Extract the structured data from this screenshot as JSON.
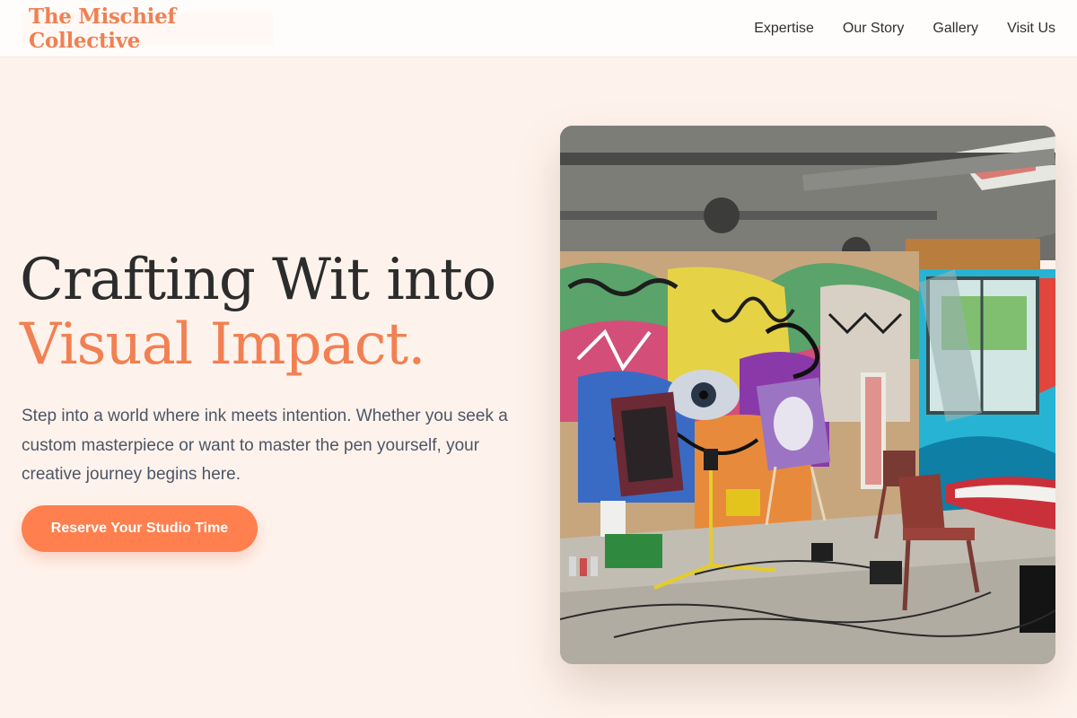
{
  "brand": {
    "name": "The Mischief Collective"
  },
  "nav": {
    "items": [
      {
        "label": "Expertise"
      },
      {
        "label": "Our Story"
      },
      {
        "label": "Gallery"
      },
      {
        "label": "Visit Us"
      }
    ]
  },
  "hero": {
    "title_line1": "Crafting Wit into",
    "title_line2": "Visual Impact.",
    "description": "Step into a world where ink meets intention. Whether you seek a custom masterpiece or want to master the pen yourself, your creative journey begins here.",
    "cta_label": "Reserve Your Studio Time"
  },
  "colors": {
    "accent": "#ff7f4e",
    "brand": "#f08052",
    "background": "#fef3ec",
    "heading": "#2c2c2c",
    "body_text": "#4d5566"
  }
}
